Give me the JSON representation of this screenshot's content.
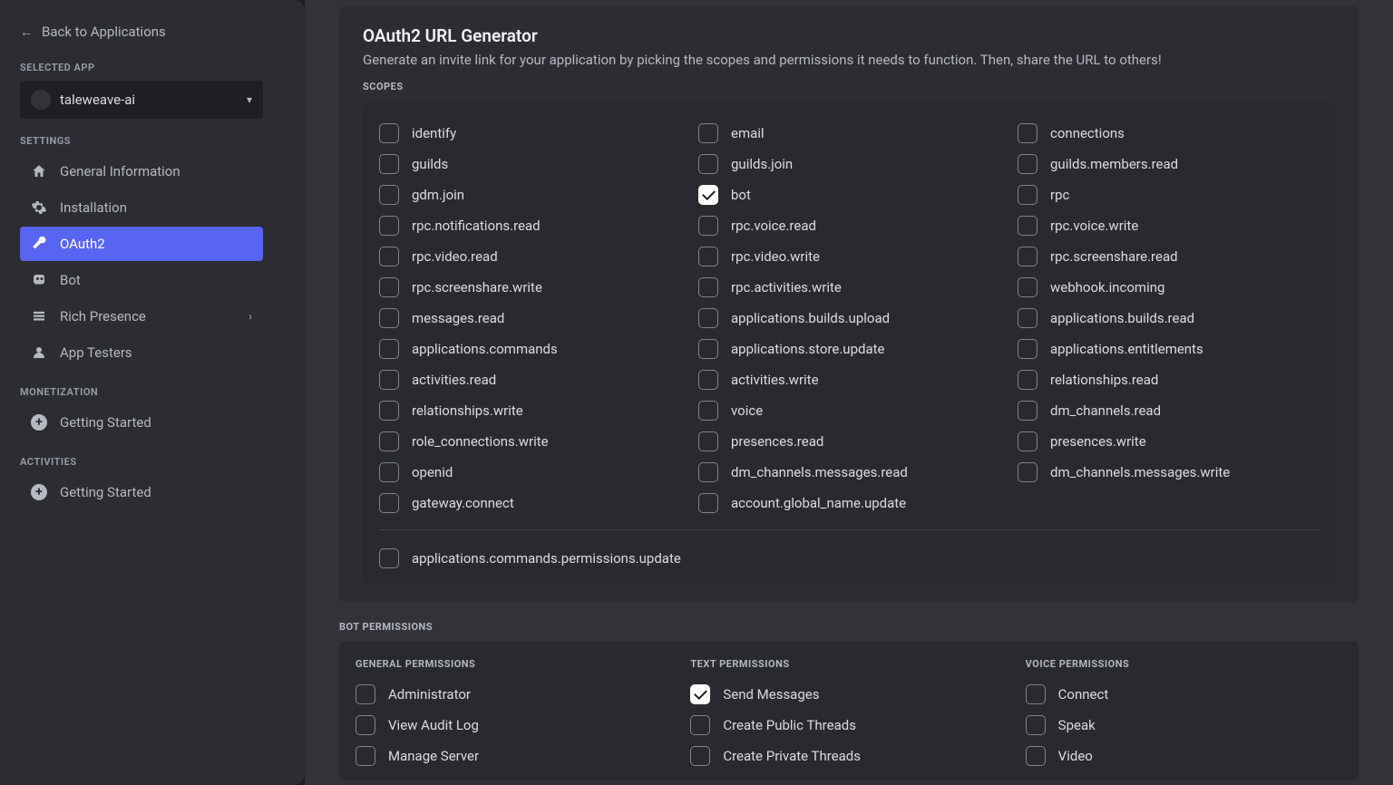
{
  "sidebar": {
    "back_label": "Back to Applications",
    "selected_app_header": "SELECTED APP",
    "app_name": "taleweave-ai",
    "settings_header": "SETTINGS",
    "nav": {
      "general": "General Information",
      "installation": "Installation",
      "oauth2": "OAuth2",
      "bot": "Bot",
      "rich_presence": "Rich Presence",
      "app_testers": "App Testers"
    },
    "monetization_header": "MONETIZATION",
    "monetization_item": "Getting Started",
    "activities_header": "ACTIVITIES",
    "activities_item": "Getting Started"
  },
  "main": {
    "title": "OAuth2 URL Generator",
    "subtitle": "Generate an invite link for your application by picking the scopes and permissions it needs to function. Then, share the URL to others!",
    "scopes_header": "SCOPES",
    "bot_perms_header": "BOT PERMISSIONS",
    "perm_cols": {
      "general": "GENERAL PERMISSIONS",
      "text": "TEXT PERMISSIONS",
      "voice": "VOICE PERMISSIONS"
    }
  },
  "scopes": [
    {
      "label": "identify",
      "checked": false
    },
    {
      "label": "email",
      "checked": false
    },
    {
      "label": "connections",
      "checked": false
    },
    {
      "label": "guilds",
      "checked": false
    },
    {
      "label": "guilds.join",
      "checked": false
    },
    {
      "label": "guilds.members.read",
      "checked": false
    },
    {
      "label": "gdm.join",
      "checked": false
    },
    {
      "label": "bot",
      "checked": true
    },
    {
      "label": "rpc",
      "checked": false
    },
    {
      "label": "rpc.notifications.read",
      "checked": false
    },
    {
      "label": "rpc.voice.read",
      "checked": false
    },
    {
      "label": "rpc.voice.write",
      "checked": false
    },
    {
      "label": "rpc.video.read",
      "checked": false
    },
    {
      "label": "rpc.video.write",
      "checked": false
    },
    {
      "label": "rpc.screenshare.read",
      "checked": false
    },
    {
      "label": "rpc.screenshare.write",
      "checked": false
    },
    {
      "label": "rpc.activities.write",
      "checked": false
    },
    {
      "label": "webhook.incoming",
      "checked": false
    },
    {
      "label": "messages.read",
      "checked": false
    },
    {
      "label": "applications.builds.upload",
      "checked": false
    },
    {
      "label": "applications.builds.read",
      "checked": false
    },
    {
      "label": "applications.commands",
      "checked": false
    },
    {
      "label": "applications.store.update",
      "checked": false
    },
    {
      "label": "applications.entitlements",
      "checked": false
    },
    {
      "label": "activities.read",
      "checked": false
    },
    {
      "label": "activities.write",
      "checked": false
    },
    {
      "label": "relationships.read",
      "checked": false
    },
    {
      "label": "relationships.write",
      "checked": false
    },
    {
      "label": "voice",
      "checked": false
    },
    {
      "label": "dm_channels.read",
      "checked": false
    },
    {
      "label": "role_connections.write",
      "checked": false
    },
    {
      "label": "presences.read",
      "checked": false
    },
    {
      "label": "presences.write",
      "checked": false
    },
    {
      "label": "openid",
      "checked": false
    },
    {
      "label": "dm_channels.messages.read",
      "checked": false
    },
    {
      "label": "dm_channels.messages.write",
      "checked": false
    },
    {
      "label": "gateway.connect",
      "checked": false
    },
    {
      "label": "account.global_name.update",
      "checked": false
    }
  ],
  "scopes_last": [
    {
      "label": "applications.commands.permissions.update",
      "checked": false
    }
  ],
  "perms_general": [
    {
      "label": "Administrator",
      "checked": false
    },
    {
      "label": "View Audit Log",
      "checked": false
    },
    {
      "label": "Manage Server",
      "checked": false
    }
  ],
  "perms_text": [
    {
      "label": "Send Messages",
      "checked": true
    },
    {
      "label": "Create Public Threads",
      "checked": false
    },
    {
      "label": "Create Private Threads",
      "checked": false
    }
  ],
  "perms_voice": [
    {
      "label": "Connect",
      "checked": false
    },
    {
      "label": "Speak",
      "checked": false
    },
    {
      "label": "Video",
      "checked": false
    }
  ]
}
